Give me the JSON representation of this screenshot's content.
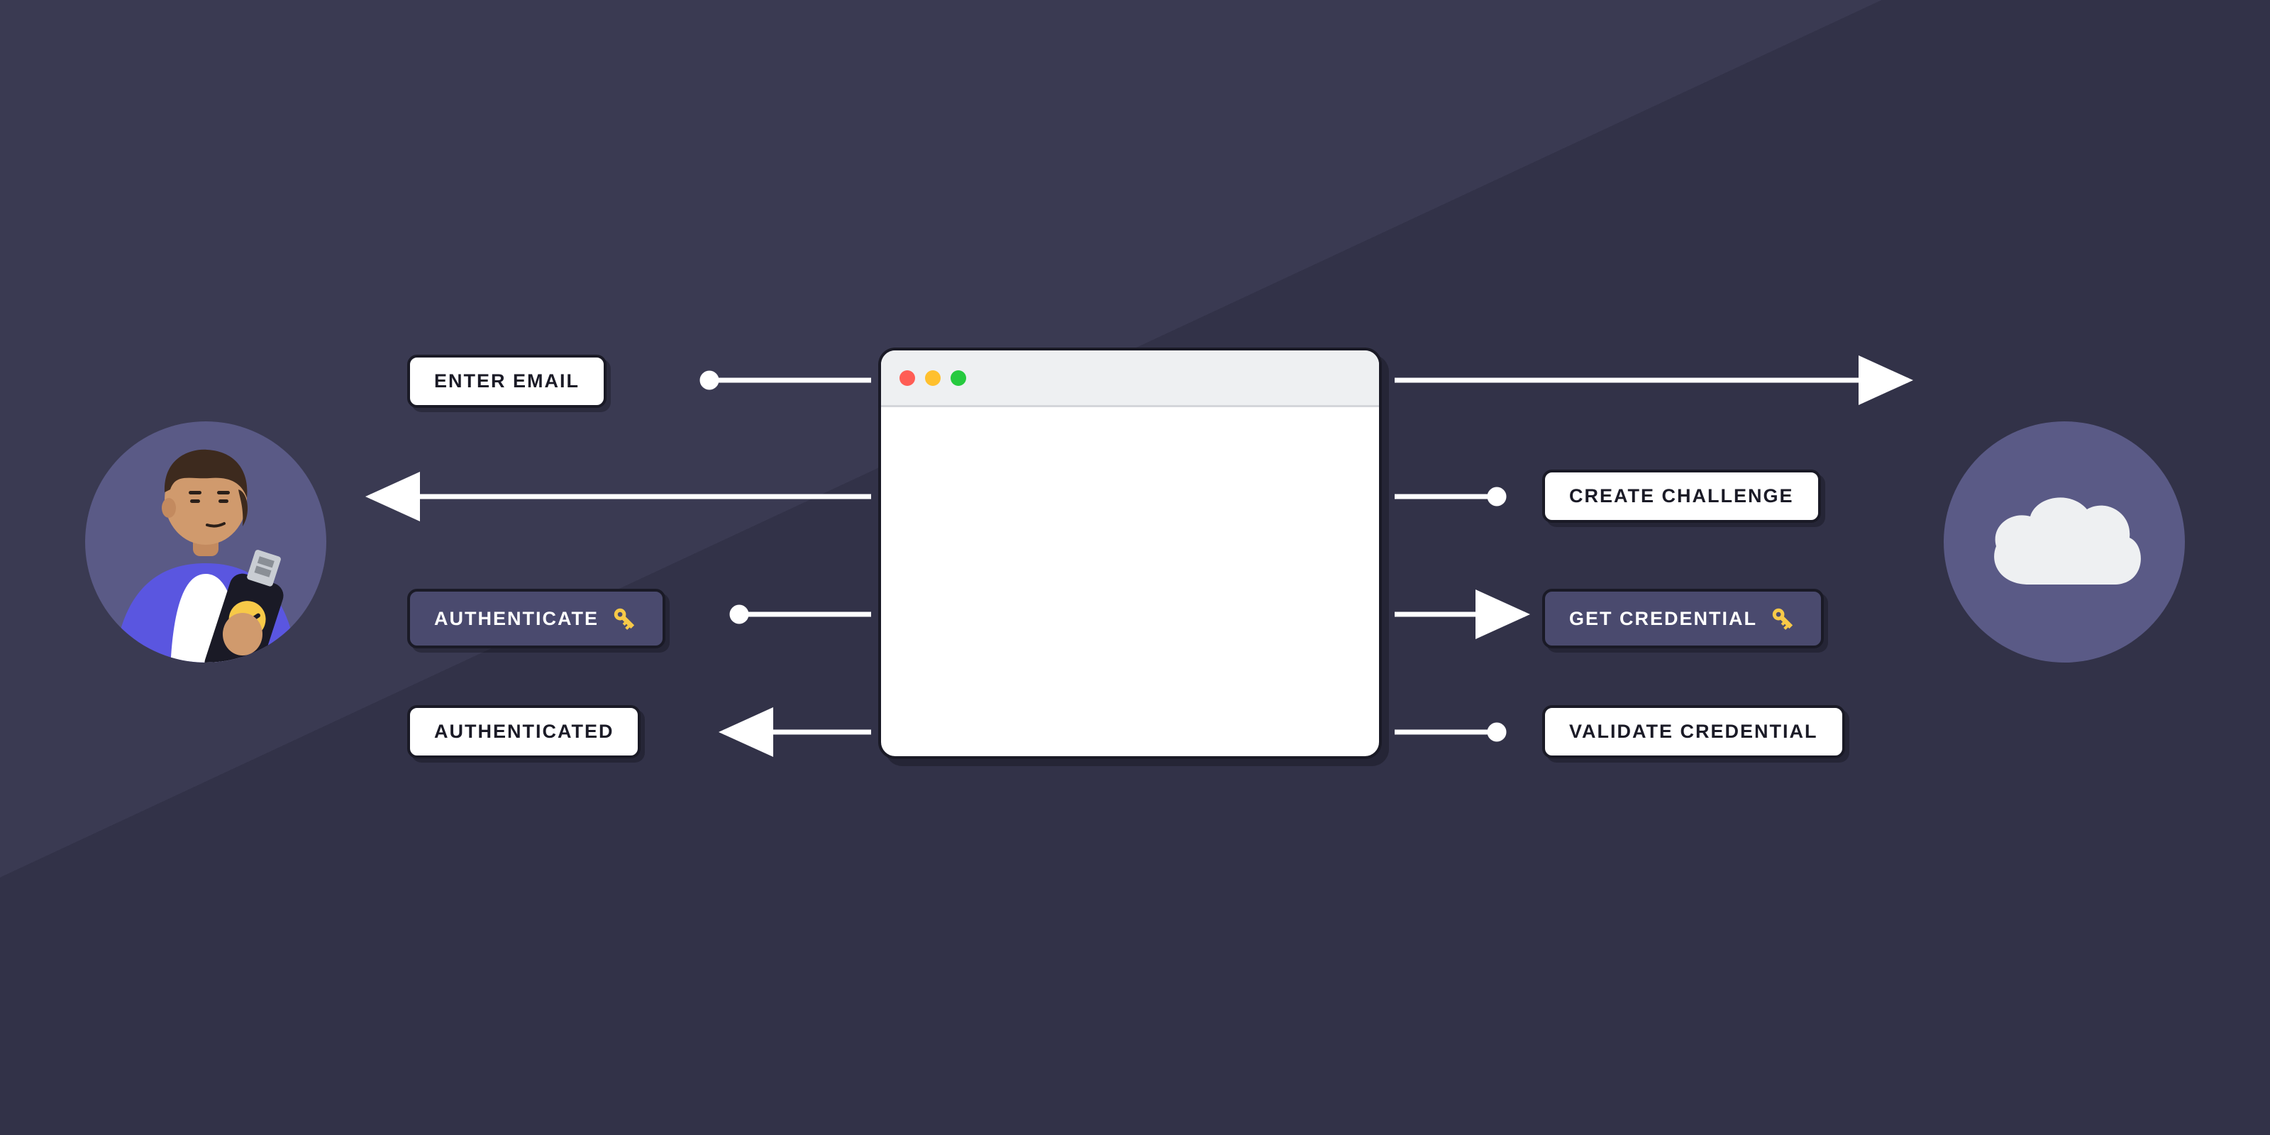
{
  "labels": {
    "enter_email": "ENTER EMAIL",
    "authenticate": "AUTHENTICATE",
    "authenticated": "AUTHENTICATED",
    "create_challenge": "CREATE CHALLENGE",
    "get_credential": "GET CREDENTIAL",
    "validate_credential": "VALIDATE CREDENTIAL"
  },
  "actors": {
    "user": "user-with-security-key",
    "client": "browser-window",
    "server": "cloud-server"
  },
  "flow": [
    {
      "from": "user",
      "to": "client",
      "label": "ENTER EMAIL"
    },
    {
      "from": "client",
      "to": "server",
      "label": ""
    },
    {
      "from": "server",
      "to": "client",
      "label": "CREATE CHALLENGE"
    },
    {
      "from": "client",
      "to": "user",
      "label": ""
    },
    {
      "from": "user",
      "to": "client",
      "label": "AUTHENTICATE"
    },
    {
      "from": "client",
      "to": "server",
      "label": "GET CREDENTIAL"
    },
    {
      "from": "server",
      "to": "client",
      "label": "VALIDATE CREDENTIAL"
    },
    {
      "from": "client",
      "to": "user",
      "label": "AUTHENTICATED"
    }
  ],
  "colors": {
    "bg_top": "#3a3a52",
    "bg_bottom": "#323248",
    "circle": "#5a5a86",
    "pill_border": "#1a1a26",
    "pill_dark": "#4a4a6e",
    "key": "#f7c948",
    "white": "#ffffff"
  }
}
